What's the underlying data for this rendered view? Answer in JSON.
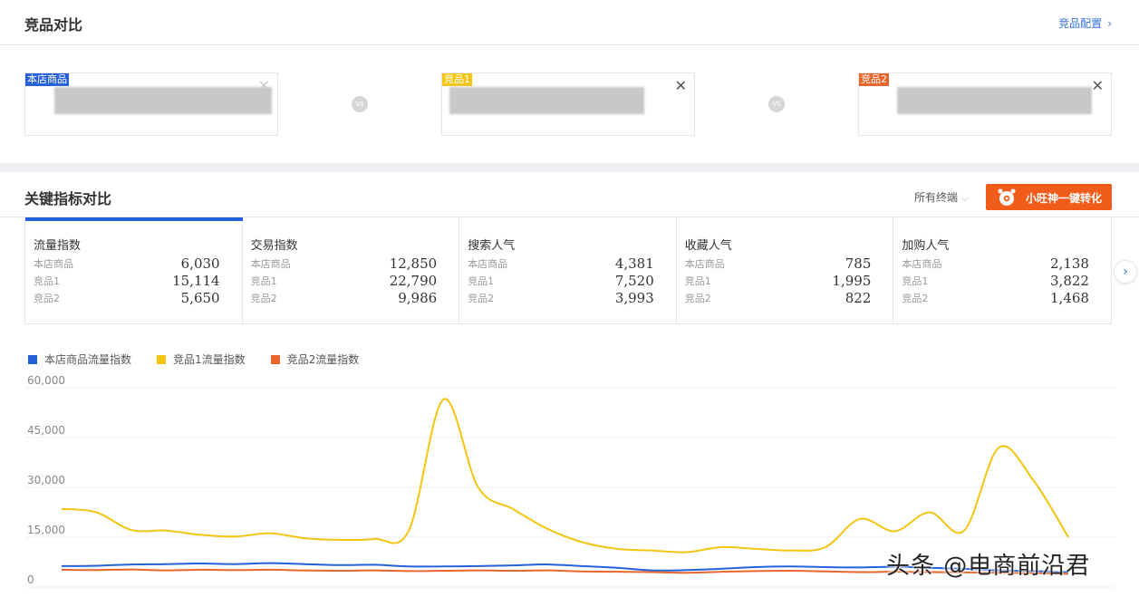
{
  "header": {
    "title": "竞品对比",
    "config_link": "竞品配置",
    "config_icon": "chevron-right-icon"
  },
  "compare": {
    "vs_label": "VS",
    "cards": [
      {
        "tag": "本店商品",
        "tag_color": "#2561d8"
      },
      {
        "tag": "竞品1",
        "tag_color": "#f2c511"
      },
      {
        "tag": "竞品2",
        "tag_color": "#e8662b"
      }
    ],
    "close_glyph": "✕"
  },
  "kpi": {
    "title": "关键指标对比",
    "terminal": "所有终端",
    "convert_button": "小旺神一键转化",
    "metrics": [
      {
        "title": "流量指数",
        "rows": [
          {
            "label": "本店商品",
            "value": "6,030"
          },
          {
            "label": "竞品1",
            "value": "15,114"
          },
          {
            "label": "竞品2",
            "value": "5,650"
          }
        ]
      },
      {
        "title": "交易指数",
        "rows": [
          {
            "label": "本店商品",
            "value": "12,850"
          },
          {
            "label": "竞品1",
            "value": "22,790"
          },
          {
            "label": "竞品2",
            "value": "9,986"
          }
        ]
      },
      {
        "title": "搜索人气",
        "rows": [
          {
            "label": "本店商品",
            "value": "4,381"
          },
          {
            "label": "竞品1",
            "value": "7,520"
          },
          {
            "label": "竞品2",
            "value": "3,993"
          }
        ]
      },
      {
        "title": "收藏人气",
        "rows": [
          {
            "label": "本店商品",
            "value": "785"
          },
          {
            "label": "竞品1",
            "value": "1,995"
          },
          {
            "label": "竞品2",
            "value": "822"
          }
        ]
      },
      {
        "title": "加购人气",
        "rows": [
          {
            "label": "本店商品",
            "value": "2,138"
          },
          {
            "label": "竞品1",
            "value": "3,822"
          },
          {
            "label": "竞品2",
            "value": "1,468"
          }
        ]
      }
    ]
  },
  "chart_data": {
    "type": "line",
    "title": "",
    "xlabel": "",
    "ylabel": "",
    "ylim": [
      0,
      60000
    ],
    "yticks": [
      "60,000",
      "45,000",
      "30,000",
      "15,000",
      "0"
    ],
    "grid": true,
    "legend_position": "top-left",
    "x": [
      1,
      2,
      3,
      4,
      5,
      6,
      7,
      8,
      9,
      10,
      11,
      12,
      13,
      14,
      15,
      16,
      17,
      18,
      19,
      20,
      21,
      22,
      23,
      24,
      25,
      26,
      27,
      28,
      29,
      30
    ],
    "series": [
      {
        "name": "本店商品流量指数",
        "color": "#2561d8",
        "values": [
          6300,
          6400,
          6800,
          6900,
          7100,
          6900,
          7200,
          6900,
          6600,
          6700,
          6200,
          6200,
          6300,
          6500,
          6800,
          6300,
          5800,
          5000,
          5100,
          5500,
          6000,
          6200,
          6000,
          5900,
          6100,
          5800,
          5500,
          5000,
          4800,
          4500
        ]
      },
      {
        "name": "竞品1流量指数",
        "color": "#f2c511",
        "values": [
          23500,
          22500,
          17200,
          17000,
          15700,
          15200,
          16200,
          14700,
          14200,
          14500,
          17000,
          56500,
          30000,
          23500,
          17500,
          13500,
          11500,
          11000,
          10500,
          12000,
          11500,
          11000,
          12000,
          20500,
          16800,
          22500,
          17000,
          42000,
          32000,
          15000
        ]
      },
      {
        "name": "竞品2流量指数",
        "color": "#e8662b",
        "values": [
          5200,
          5100,
          5300,
          5000,
          5200,
          5100,
          5200,
          5000,
          4900,
          5000,
          4800,
          4900,
          5000,
          4900,
          5000,
          4700,
          4600,
          4500,
          4300,
          4600,
          4800,
          4900,
          4700,
          4500,
          4600,
          4500,
          4400,
          4300,
          4200,
          4000
        ]
      }
    ]
  },
  "watermark": "头条 @电商前沿君"
}
